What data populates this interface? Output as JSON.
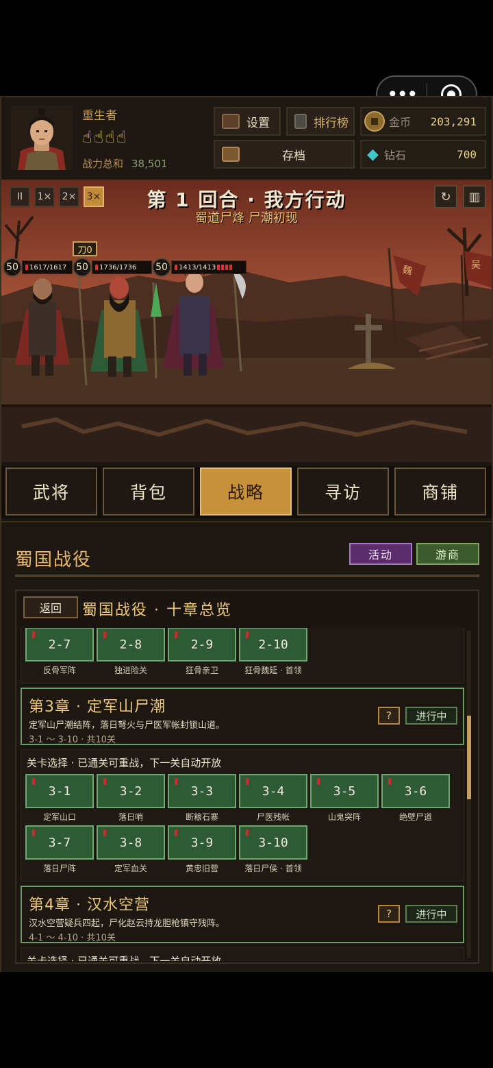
{
  "header": {
    "player_name": "重生者",
    "power_label": "战力总和",
    "power_value": "38,501",
    "settings_label": "设置",
    "ranking_label": "排行榜",
    "save_label": "存档",
    "gold_label": "金币",
    "gold_value": "203,291",
    "diamond_label": "钻石",
    "diamond_value": "700"
  },
  "battle": {
    "speeds": [
      "II",
      "1×",
      "2×",
      "3×"
    ],
    "active_speed": "3×",
    "round_title": "第 1 回合 · 我方行动",
    "subtitle": "蜀道尸烽 尸潮初现",
    "weapon_badge": "刀0",
    "units": [
      {
        "level": "50",
        "hp": "1617/1617"
      },
      {
        "level": "50",
        "hp": "1736/1736"
      },
      {
        "level": "50",
        "hp": "1413/1413"
      }
    ],
    "banner_left": "魏",
    "banner_right": "吴"
  },
  "tabs": [
    "武将",
    "背包",
    "战略",
    "寻访",
    "商铺"
  ],
  "active_tab": "战略",
  "panel": {
    "title": "蜀国战役",
    "event_label": "活动",
    "merchant_label": "游商",
    "back_label": "返回",
    "box_title": "蜀国战役 · 十章总览",
    "partial_stages": [
      {
        "id": "2-7",
        "name": "反骨军阵"
      },
      {
        "id": "2-8",
        "name": "独进险关"
      },
      {
        "id": "2-9",
        "name": "狂骨亲卫"
      },
      {
        "id": "2-10",
        "name": "狂骨魏延 · 首领"
      }
    ],
    "chapter3": {
      "title": "第3章 · 定军山尸潮",
      "desc": "定军山尸潮结阵，落日弩火与尸医军帐封锁山道。",
      "range": "3-1 ～ 3-10 · 共10关",
      "help": "?",
      "status": "进行中"
    },
    "chapter3_hint": "关卡选择 · 已通关可重战，下一关自动开放",
    "chapter3_stages_row1": [
      {
        "id": "3-1",
        "name": "定军山口"
      },
      {
        "id": "3-2",
        "name": "落日哨"
      },
      {
        "id": "3-3",
        "name": "断粮石寨"
      },
      {
        "id": "3-4",
        "name": "尸医残帐"
      },
      {
        "id": "3-5",
        "name": "山鬼突阵"
      },
      {
        "id": "3-6",
        "name": "绝壁尸道"
      }
    ],
    "chapter3_stages_row2": [
      {
        "id": "3-7",
        "name": "落日尸阵"
      },
      {
        "id": "3-8",
        "name": "定军血关"
      },
      {
        "id": "3-9",
        "name": "黄忠旧营"
      },
      {
        "id": "3-10",
        "name": "落日尸侯 · 首领"
      }
    ],
    "chapter4": {
      "title": "第4章 · 汉水空营",
      "desc": "汉水空营疑兵四起，尸化赵云持龙胆枪镇守残阵。",
      "range": "4-1 ～ 4-10 · 共10关",
      "help": "?",
      "status": "进行中"
    },
    "chapter4_hint": "关卡选择 · 已通关可重战，下一关自动开放"
  }
}
